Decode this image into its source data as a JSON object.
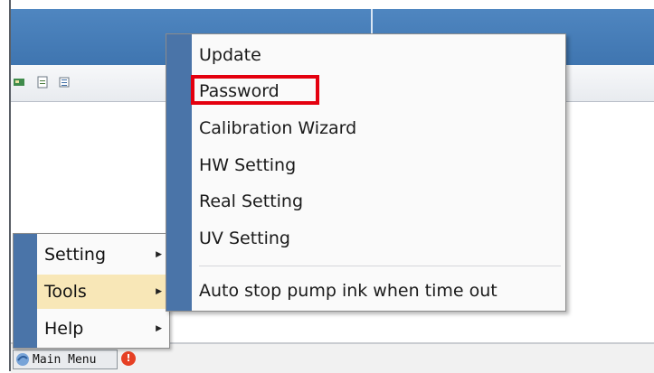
{
  "main_menu": {
    "items": [
      {
        "label": "Setting",
        "has_submenu": true
      },
      {
        "label": "Tools",
        "has_submenu": true,
        "selected": true
      },
      {
        "label": "Help",
        "has_submenu": true
      }
    ]
  },
  "tools_submenu": {
    "items": [
      {
        "label": "Update"
      },
      {
        "label": "Password",
        "highlighted": true
      },
      {
        "label": "Calibration Wizard"
      },
      {
        "label": "HW Setting"
      },
      {
        "label": "Real Setting"
      },
      {
        "label": "UV Setting"
      },
      {
        "label": "Auto stop pump ink when time out"
      }
    ]
  },
  "taskbar": {
    "start_label": "Main Menu",
    "alert_symbol": "!"
  },
  "colors": {
    "title_blue": "#4a80bd",
    "menu_stripe": "#4a74a8",
    "selection": "#f8e7b7",
    "highlight_red": "#e4000f"
  },
  "icons": [
    "picture-icon",
    "document-icon",
    "list-icon",
    "app-logo-icon",
    "alert-icon",
    "submenu-arrow-icon"
  ]
}
